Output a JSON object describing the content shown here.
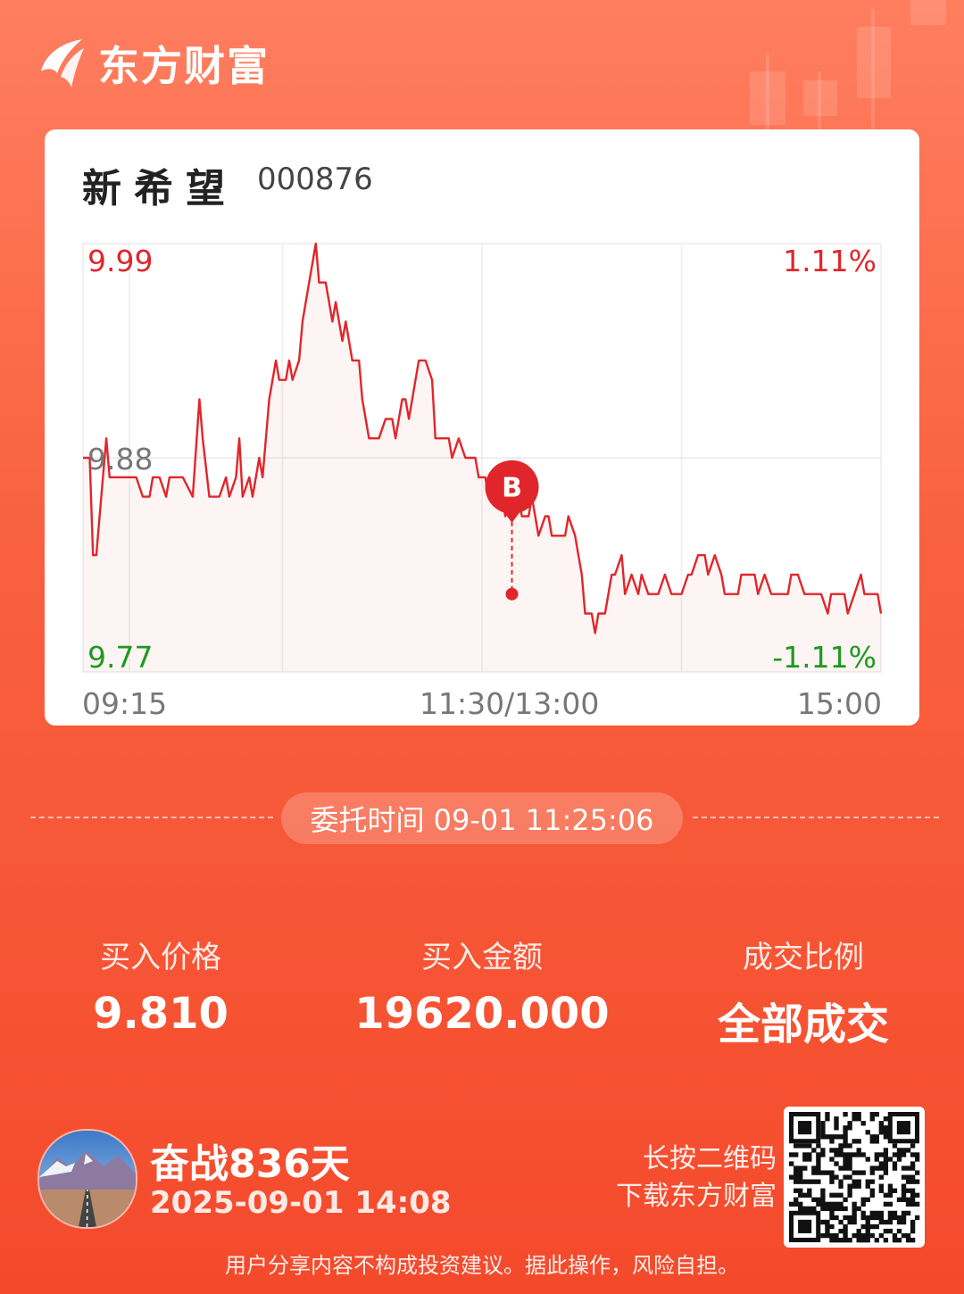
{
  "brand": {
    "name": "东方财富",
    "logo_icon": "eastmoney-logo-icon"
  },
  "stock": {
    "name": "新希望",
    "code": "000876"
  },
  "chart_data": {
    "type": "line",
    "title": "",
    "x_ticks": [
      "09:15",
      "11:30/13:00",
      "15:00"
    ],
    "y_labels": {
      "high": "9.99",
      "mid": "9.88",
      "low": "9.77"
    },
    "pct_labels": {
      "high": "1.11%",
      "low": "-1.11%"
    },
    "ylim": [
      9.77,
      9.99
    ],
    "prev_close": 9.88,
    "session_minutes": 240,
    "series": [
      {
        "color": "#e0262b",
        "x": [
          0,
          2,
          3,
          4,
          6,
          7,
          8,
          9,
          11,
          12,
          14,
          16,
          18,
          20,
          21,
          23,
          25,
          26,
          28,
          30,
          33,
          35,
          36,
          38,
          40,
          41,
          43,
          44,
          46,
          47,
          48,
          50,
          51,
          53,
          54,
          56,
          58,
          59,
          61,
          62,
          63,
          65,
          66,
          68,
          70,
          71,
          73,
          75,
          76,
          78,
          79,
          81,
          83,
          84,
          86,
          87,
          89,
          91,
          93,
          94,
          96,
          97,
          98,
          100,
          101,
          103,
          105,
          106,
          108,
          110,
          111,
          113,
          115,
          116,
          118,
          119,
          121,
          122,
          124,
          126,
          127,
          129,
          131,
          132,
          134,
          135,
          137,
          139,
          140,
          141,
          143,
          145,
          146,
          148,
          149,
          150,
          151,
          153,
          154,
          155,
          157,
          159,
          160,
          162,
          163,
          165,
          167,
          168,
          170,
          172,
          173,
          175,
          177,
          178,
          180,
          182,
          183,
          185,
          187,
          188,
          190,
          192,
          193,
          195,
          197,
          198,
          200,
          202,
          203,
          205,
          207,
          208,
          210,
          212,
          213,
          215,
          217,
          219,
          220,
          222,
          224,
          225,
          227,
          229,
          230,
          232,
          234,
          235,
          237,
          239,
          240
        ],
        "y": [
          9.88,
          9.88,
          9.83,
          9.83,
          9.87,
          9.89,
          9.87,
          9.87,
          9.87,
          9.87,
          9.87,
          9.87,
          9.86,
          9.86,
          9.87,
          9.87,
          9.86,
          9.87,
          9.87,
          9.87,
          9.86,
          9.91,
          9.89,
          9.86,
          9.86,
          9.86,
          9.87,
          9.86,
          9.87,
          9.89,
          9.86,
          9.87,
          9.86,
          9.88,
          9.87,
          9.91,
          9.93,
          9.92,
          9.92,
          9.93,
          9.92,
          9.93,
          9.95,
          9.97,
          9.99,
          9.97,
          9.97,
          9.95,
          9.96,
          9.94,
          9.95,
          9.93,
          9.93,
          9.91,
          9.89,
          9.89,
          9.89,
          9.9,
          9.9,
          9.89,
          9.91,
          9.91,
          9.9,
          9.92,
          9.93,
          9.93,
          9.92,
          9.89,
          9.89,
          9.89,
          9.88,
          9.89,
          9.88,
          9.88,
          9.88,
          9.87,
          9.87,
          9.86,
          9.86,
          9.86,
          9.85,
          9.86,
          9.86,
          9.85,
          9.85,
          9.86,
          9.84,
          9.85,
          9.85,
          9.84,
          9.84,
          9.84,
          9.85,
          9.84,
          9.83,
          9.82,
          9.8,
          9.8,
          9.79,
          9.8,
          9.8,
          9.82,
          9.82,
          9.83,
          9.81,
          9.82,
          9.81,
          9.82,
          9.81,
          9.81,
          9.81,
          9.82,
          9.81,
          9.81,
          9.81,
          9.82,
          9.82,
          9.83,
          9.83,
          9.82,
          9.83,
          9.82,
          9.81,
          9.81,
          9.81,
          9.82,
          9.82,
          9.82,
          9.81,
          9.82,
          9.81,
          9.81,
          9.81,
          9.81,
          9.82,
          9.82,
          9.81,
          9.81,
          9.81,
          9.81,
          9.8,
          9.81,
          9.81,
          9.81,
          9.8,
          9.81,
          9.82,
          9.81,
          9.81,
          9.81,
          9.8
        ]
      }
    ],
    "buy_marker": {
      "label": "B",
      "x": 129,
      "price": 9.81
    }
  },
  "order": {
    "time_label": "委托时间 09-01 11:25:06"
  },
  "stats": [
    {
      "label": "买入价格",
      "value": "9.810"
    },
    {
      "label": "买入金额",
      "value": "19620.000"
    },
    {
      "label": "成交比例",
      "value": "全部成交"
    }
  ],
  "user": {
    "streak": "奋战836天",
    "datetime": "2025-09-01 14:08",
    "avatar": "landscape-road-avatar"
  },
  "qr": {
    "hint_line1": "长按二维码",
    "hint_line2": "下载东方财富",
    "icon": "qr-code-icon"
  },
  "disclaimer": "用户分享内容不构成投资建议。据此操作，风险自担。",
  "colors": {
    "up": "#e0262b",
    "down": "#1e9a1e",
    "background": "#f9623f"
  }
}
